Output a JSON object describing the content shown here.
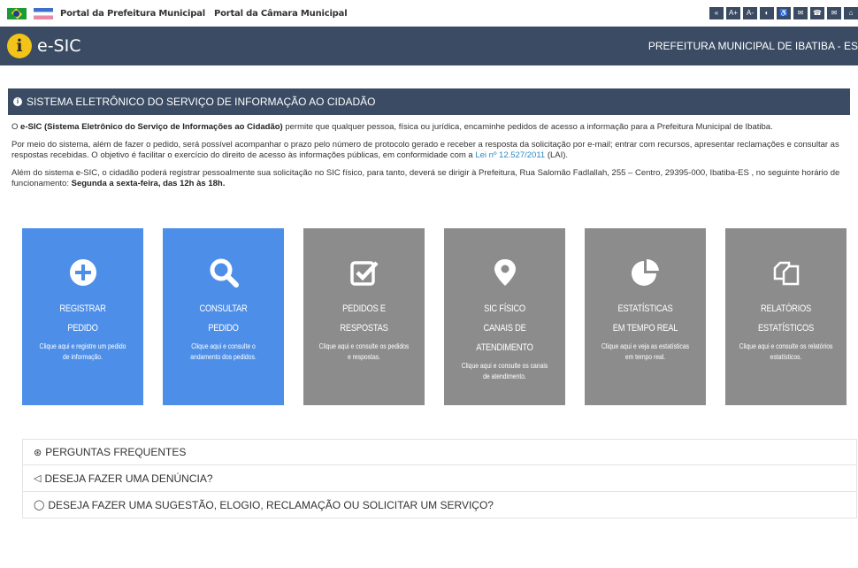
{
  "topbar": {
    "portal_prefeitura": "Portal da Prefeitura Municipal",
    "portal_camara": "Portal da Câmara Municipal",
    "a11y_buttons": [
      "«",
      "A+",
      "A-",
      "◐",
      "♿",
      "✉",
      "☎",
      "✉",
      "⌂"
    ]
  },
  "header": {
    "logo_letter": "i",
    "app_name": "e-SIC",
    "org_name": "PREFEITURA MUNICIPAL DE IBATIBA - ES"
  },
  "panel": {
    "title": "SISTEMA ELETRÔNICO DO SERVIÇO DE INFORMAÇÃO AO CIDADÃO",
    "p1_prefix": "O ",
    "p1_bold": "e-SIC (Sistema Eletrônico do Serviço de Informações ao Cidadão)",
    "p1_rest": " permite que qualquer pessoa, física ou jurídica, encaminhe pedidos de acesso a informação para a Prefeitura Municipal de Ibatiba.",
    "p2_text": "Por meio do sistema, além de fazer o pedido, será possível acompanhar o prazo pelo número de protocolo gerado e receber a resposta da solicitação por e-mail; entrar com recursos, apresentar reclamações e consultar as respostas recebidas. O objetivo é facilitar o exercício do direito de acesso às informações públicas, em conformidade com a ",
    "p2_link": "Lei nº 12.527/2011",
    "p2_suffix": " (LAI).",
    "p3_text": "Além do sistema e-SIC, o cidadão poderá registrar pessoalmente sua solicitação no SIC físico, para tanto, deverá se dirigir à Prefeitura, Rua Salomão Fadlallah, 255 – Centro, 29395-000, Ibatiba-ES , no seguinte horário de funcionamento: ",
    "p3_bold": "Segunda a sexta-feira, das 12h às 18h."
  },
  "tiles": [
    {
      "l1": "REGISTRAR",
      "l2": "PEDIDO",
      "l3": "",
      "desc": "Clique aqui e registre um pedido de informação.",
      "icon": "plus-circle-icon",
      "color": "#4d8fe8"
    },
    {
      "l1": "CONSULTAR",
      "l2": "PEDIDO",
      "l3": "",
      "desc": "Clique aqui e consulte o andamento dos pedidos.",
      "icon": "search-icon",
      "color": "#4d8fe8"
    },
    {
      "l1": "PEDIDOS E",
      "l2": "RESPOSTAS",
      "l3": "",
      "desc": "Clique aqui e consulte os pedidos e respostas.",
      "icon": "checkbox-icon",
      "color": "#8c8c8c"
    },
    {
      "l1": "SIC FÍSICO",
      "l2": "CANAIS DE",
      "l3": "ATENDIMENTO",
      "desc": "Clique aqui e consulte os canais de atendimento.",
      "icon": "map-marker-icon",
      "color": "#8c8c8c"
    },
    {
      "l1": "ESTATÍSTICAS",
      "l2": "EM TEMPO REAL",
      "l3": "",
      "desc": "Clique aqui e veja as estatísticas em tempo real.",
      "icon": "pie-chart-icon",
      "color": "#8c8c8c"
    },
    {
      "l1": "RELATÓRIOS",
      "l2": "ESTATÍSTICOS",
      "l3": "",
      "desc": "Clique aqui e consulte os relatórios estatísticos.",
      "icon": "copy-icon",
      "color": "#8c8c8c"
    }
  ],
  "faq": [
    {
      "icon": "question-circle-icon",
      "glyph": "?",
      "label": "PERGUNTAS FREQUENTES"
    },
    {
      "icon": "bullhorn-icon",
      "glyph": "📢",
      "label": "DESEJA FAZER UMA DENÚNCIA?"
    },
    {
      "icon": "comment-icon",
      "glyph": "💬",
      "label": "DESEJA FAZER UMA SUGESTÃO, ELOGIO, RECLAMAÇÃO OU SOLICITAR UM SERVIÇO?"
    }
  ]
}
